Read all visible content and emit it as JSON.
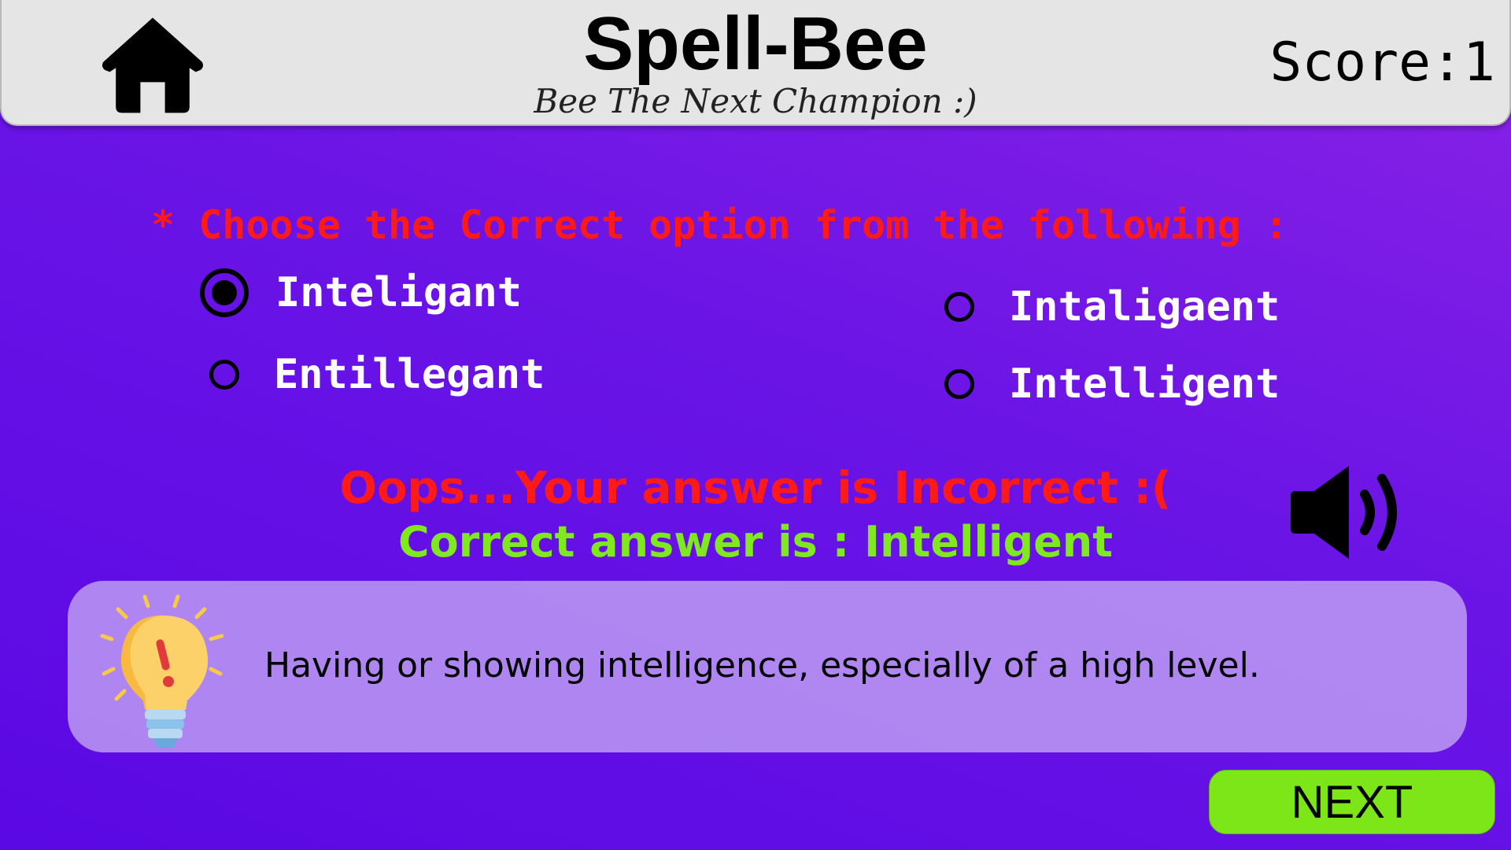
{
  "header": {
    "title": "Spell-Bee",
    "subtitle": "Bee The Next Champion :)",
    "score": "Score:1"
  },
  "question": {
    "prompt": "* Choose the Correct option from the following :",
    "options": [
      {
        "label": "Inteligant",
        "selected": true
      },
      {
        "label": "Intaligaent",
        "selected": false
      },
      {
        "label": "Entillegant",
        "selected": false
      },
      {
        "label": "Intelligent",
        "selected": false
      }
    ]
  },
  "feedback": {
    "wrong": "Oops...Your answer is Incorrect :(",
    "correct": "Correct answer is : Intelligent"
  },
  "hint": {
    "icon": "lightbulb-icon",
    "definition": "Having or showing intelligence, especially of a high level."
  },
  "actions": {
    "next_label": "NEXT",
    "home_icon": "home-icon",
    "speaker_icon": "speaker-icon"
  },
  "colors": {
    "background_top": "#8a22e6",
    "background_bottom": "#5a08e4",
    "header": "#e5e5e5",
    "prompt": "#ff1a1a",
    "wrong": "#ff1a1a",
    "correct": "#80e81e",
    "next_button": "#7de619",
    "hint_card": "#cdb4f5"
  }
}
